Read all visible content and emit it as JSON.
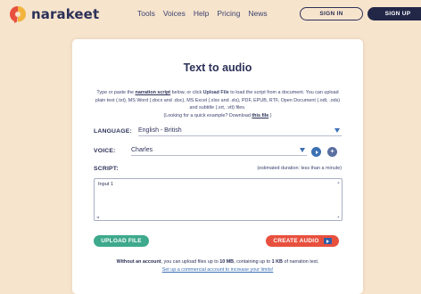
{
  "header": {
    "logo_text": "narakeet",
    "nav": [
      "Tools",
      "Voices",
      "Help",
      "Pricing",
      "News"
    ],
    "signin_label": "SIGN IN",
    "signup_label": "SIGN UP"
  },
  "main": {
    "title": "Text to audio",
    "description": {
      "part1": "Type or paste the ",
      "link_narration": "narration script",
      "part2": " below, or click ",
      "upload_word": "Upload File",
      "part3": " to load the script from a document. You can upload plain text (.txt), MS Word (.docx and .doc), MS Excel (.xlsx and .xls), PDF, EPUB, RTF, Open Document (.odt, .ods) and subtitle (.srt, .vtt) files.",
      "part4": "(Looking for a quick example? Download ",
      "link_example": "this file",
      "part5": ".)"
    },
    "language": {
      "label": "LANGUAGE:",
      "value": "English - British"
    },
    "voice": {
      "label": "VOICE:",
      "value": "Charles"
    },
    "script": {
      "label": "SCRIPT:",
      "duration": "(estimated duration: less than a minute)",
      "value": "Input 1"
    },
    "upload_label": "UPLOAD FILE",
    "create_label": "CREATE AUDIO",
    "footer": {
      "line1_part1": "Without an account",
      "line1_part2": ", you can upload files up to ",
      "line1_size": "10 MB",
      "line1_part3": ", containing up to ",
      "line1_limit": "1 KB",
      "line1_part4": " of narration text.",
      "link_commercial": "Set up a commercial account to increase your limits!"
    }
  },
  "colors": {
    "page_bg": "#f7e4cd",
    "navy": "#2c3158",
    "accent_blue": "#3a6fb4",
    "upload_green": "#3ea98c",
    "create_red": "#e8503e",
    "logo_red": "#e8503e",
    "logo_yellow": "#f3b43f"
  },
  "icons": {
    "logo": "narakeet-speech-bubble-icon",
    "dropdown": "chevron-down-icon",
    "preview": "play-icon",
    "add_voice": "plus-icon",
    "create": "play-icon"
  }
}
